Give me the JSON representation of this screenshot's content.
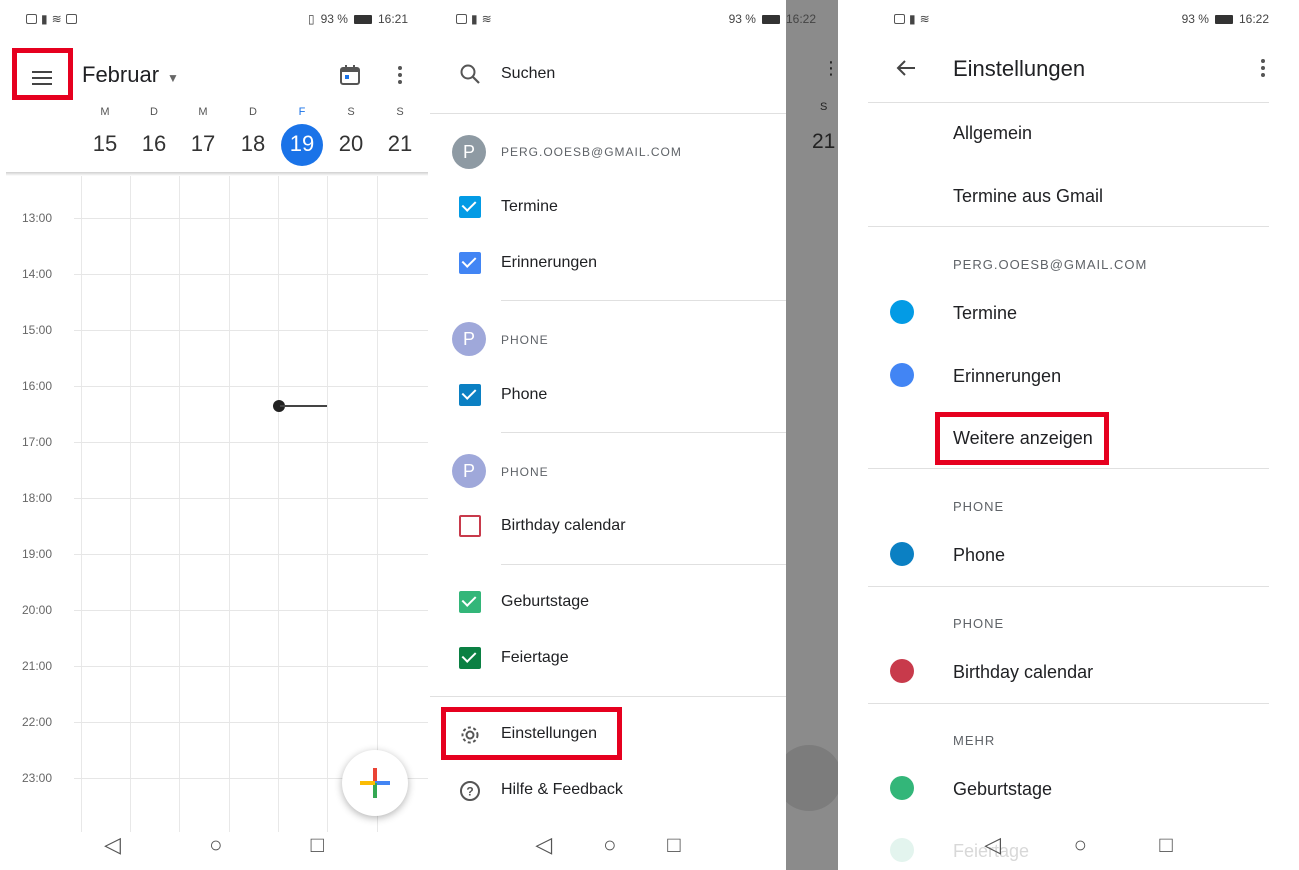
{
  "panel1": {
    "status_time": "16:21",
    "battery": "93 %",
    "month": "Februar",
    "weekdays": [
      "M",
      "D",
      "M",
      "D",
      "F",
      "S",
      "S"
    ],
    "days": [
      "15",
      "16",
      "17",
      "18",
      "19",
      "20",
      "21"
    ],
    "hours": [
      "13:00",
      "14:00",
      "15:00",
      "16:00",
      "17:00",
      "18:00",
      "19:00",
      "20:00",
      "21:00",
      "22:00",
      "23:00"
    ]
  },
  "panel2": {
    "status_time": "16:22",
    "battery": "93 %",
    "search_label": "Suchen",
    "account": "PERG.OOESB@GMAIL.COM",
    "account_initial": "P",
    "items_account": [
      {
        "label": "Termine",
        "color": "#039be5"
      },
      {
        "label": "Erinnerungen",
        "color": "#4285f4"
      }
    ],
    "phone1_header": "PHONE",
    "phone1_initial": "P",
    "phone1_item": {
      "label": "Phone",
      "color": "#0b80c3"
    },
    "phone2_header": "PHONE",
    "phone2_initial": "P",
    "phone2_item": {
      "label": "Birthday calendar",
      "color": "#c83a4b"
    },
    "more_items": [
      {
        "label": "Geburtstage",
        "color": "#33b679"
      },
      {
        "label": "Feiertage",
        "color": "#0b8043"
      }
    ],
    "settings_label": "Einstellungen",
    "help_label": "Hilfe & Feedback",
    "behind_day_header": "S",
    "behind_day_number": "21"
  },
  "panel3": {
    "status_time": "16:22",
    "battery": "93 %",
    "title": "Einstellungen",
    "general": "Allgemein",
    "gmail_events": "Termine aus Gmail",
    "account": "PERG.OOESB@GMAIL.COM",
    "account_items": [
      {
        "label": "Termine",
        "color": "#039be5"
      },
      {
        "label": "Erinnerungen",
        "color": "#4285f4"
      }
    ],
    "show_more": "Weitere anzeigen",
    "phone1_header": "PHONE",
    "phone1_item": {
      "label": "Phone",
      "color": "#0b80c3"
    },
    "phone2_header": "PHONE",
    "phone2_item": {
      "label": "Birthday calendar",
      "color": "#c83a4b"
    },
    "more_header": "MEHR",
    "more_item": {
      "label": "Geburtstage",
      "color": "#33b679"
    },
    "partial_item": "Feiertage"
  }
}
